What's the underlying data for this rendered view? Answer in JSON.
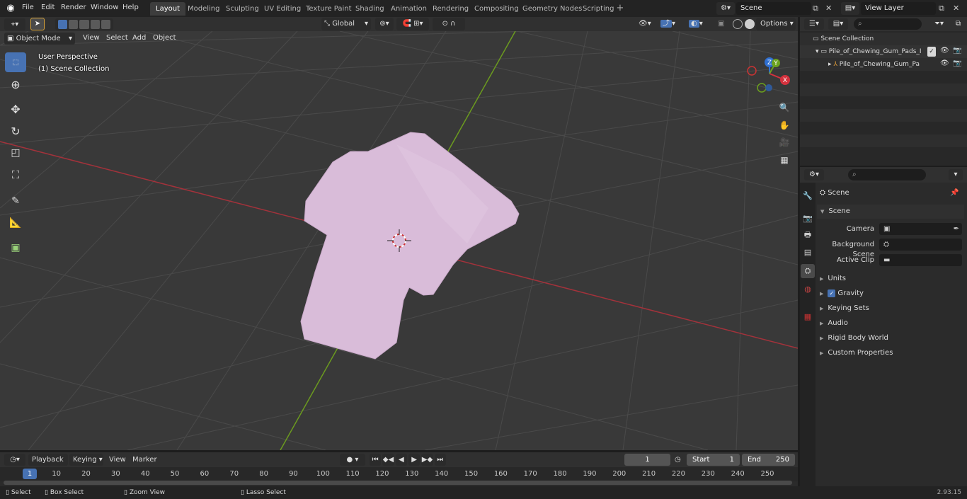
{
  "topbar": {
    "menu": [
      "File",
      "Edit",
      "Render",
      "Window",
      "Help"
    ],
    "workspaces": [
      "Layout",
      "Modeling",
      "Sculpting",
      "UV Editing",
      "Texture Paint",
      "Shading",
      "Animation",
      "Rendering",
      "Compositing",
      "Geometry Nodes",
      "Scripting"
    ],
    "active_workspace": "Layout",
    "scene_name": "Scene",
    "view_layer": "View Layer"
  },
  "viewport_header": {
    "mode": "Object Mode",
    "menus": [
      "View",
      "Select",
      "Add",
      "Object"
    ],
    "transform_orientation": "Global",
    "options": "Options"
  },
  "viewport": {
    "perspective": "User Perspective",
    "collection": "(1) Scene Collection",
    "gizmo": {
      "x": "X",
      "y": "Y",
      "z": "Z"
    },
    "colors": {
      "bg": "#393939",
      "object": "#d9bcd9",
      "x_axis": "#a3323b",
      "y_axis": "#6b9a1f"
    }
  },
  "outliner": {
    "root": "Scene Collection",
    "items": [
      "Pile_of_Chewing_Gum_Pads_I",
      "Pile_of_Chewing_Gum_Pa"
    ]
  },
  "properties": {
    "title": "Scene",
    "section": "Scene",
    "fields": [
      {
        "label": "Camera",
        "value": ""
      },
      {
        "label": "Background Scene",
        "value": ""
      },
      {
        "label": "Active Clip",
        "value": ""
      }
    ],
    "panels": [
      "Units",
      "Gravity",
      "Keying Sets",
      "Audio",
      "Rigid Body World",
      "Custom Properties"
    ]
  },
  "timeline": {
    "menus": [
      "Playback",
      "Keying",
      "View",
      "Marker"
    ],
    "current_frame": "1",
    "start_label": "Start",
    "start": "1",
    "end_label": "End",
    "end": "250",
    "ticks": [
      "1",
      "10",
      "20",
      "30",
      "40",
      "50",
      "60",
      "70",
      "80",
      "90",
      "100",
      "110",
      "120",
      "130",
      "140",
      "150",
      "160",
      "170",
      "180",
      "190",
      "200",
      "210",
      "220",
      "230",
      "240",
      "250"
    ]
  },
  "statusbar": {
    "items": [
      "Select",
      "Box Select",
      "Zoom View",
      "Lasso Select"
    ],
    "version": "2.93.15"
  }
}
